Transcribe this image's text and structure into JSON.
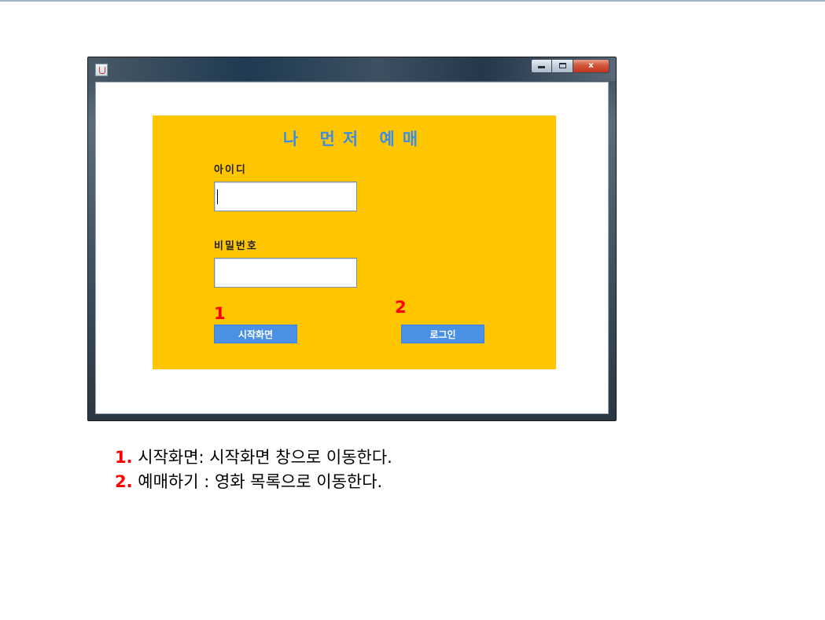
{
  "window": {
    "buttons": {
      "close_label": "x"
    }
  },
  "form": {
    "title": "나 먼저 예매",
    "id_label": "아이디",
    "id_value": "",
    "password_label": "비밀번호",
    "password_value": "",
    "marker_1": "1",
    "marker_2": "2",
    "start_button": "시작화면",
    "login_button": "로그인"
  },
  "notes": [
    {
      "num": "1.",
      "text": " 시작화면: 시작화면 창으로 이동한다."
    },
    {
      "num": "2.",
      "text": " 예매하기 : 영화 목록으로 이동한다."
    }
  ],
  "colors": {
    "panel": "#ffc600",
    "title": "#3b8de6",
    "button": "#4a90e4",
    "marker": "#ff0000"
  },
  "icons": [
    "java-app-icon",
    "minimize-icon",
    "maximize-icon",
    "close-icon"
  ]
}
